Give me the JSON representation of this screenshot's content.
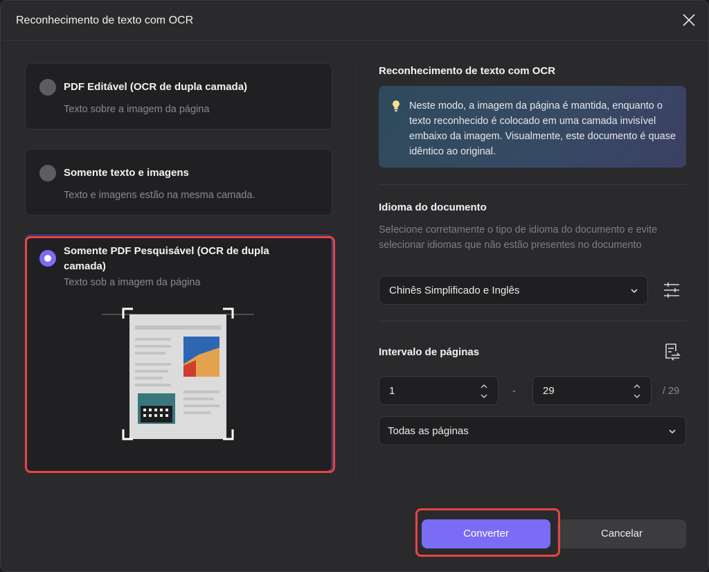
{
  "dialog": {
    "title": "Reconhecimento de texto com OCR"
  },
  "options": [
    {
      "title": "PDF Editável (OCR de dupla camada)",
      "desc": "Texto sobre a imagem da página",
      "selected": false
    },
    {
      "title": "Somente texto e imagens",
      "desc": "Texto e imagens estão na mesma camada.",
      "selected": false
    },
    {
      "title": "Somente PDF Pesquisável (OCR de dupla camada)",
      "desc": "Texto sob a imagem da página",
      "selected": true
    }
  ],
  "right": {
    "heading": "Reconhecimento de texto com OCR",
    "info": "Neste modo, a imagem da página é mantida, enquanto o texto reconhecido é colocado em uma camada invisível embaixo da imagem. Visualmente, este documento é quase idêntico ao original.",
    "language": {
      "heading": "Idioma do documento",
      "hint": "Selecione corretamente o tipo de idioma do documento e evite selecionar idiomas que não estão presentes no documento",
      "value": "Chinês Simplificado e Inglês"
    },
    "pages": {
      "heading": "Intervalo de páginas",
      "from": "1",
      "dash": "-",
      "to": "29",
      "total": "/ 29",
      "range_value": "Todas as páginas"
    }
  },
  "buttons": {
    "convert": "Converter",
    "cancel": "Cancelar"
  },
  "colors": {
    "accent": "#7b6cf6",
    "highlight": "#ea4444"
  }
}
